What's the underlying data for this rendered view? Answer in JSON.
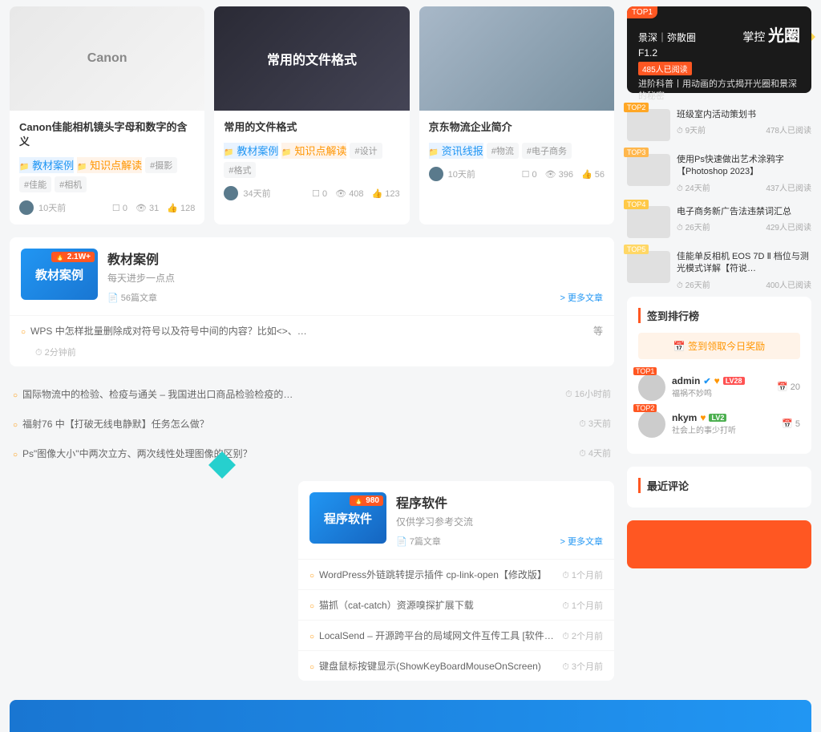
{
  "cards": [
    {
      "img_label": "Canon",
      "title": "Canon佳能相机镜头字母和数字的含义",
      "tags": [
        {
          "cls": "tag-cat blue",
          "icon": "📁",
          "label": "教材案例"
        },
        {
          "cls": "tag-cat",
          "icon": "📁",
          "label": "知识点解读"
        },
        {
          "cls": "tag",
          "label": "#摄影"
        },
        {
          "cls": "tag",
          "label": "#佳能"
        },
        {
          "cls": "tag",
          "label": "#相机"
        }
      ],
      "time": "10天前",
      "comments": "☐ 0",
      "views": "👁 31",
      "likes": "👍 128"
    },
    {
      "img_label": "常用的文件格式",
      "title": "常用的文件格式",
      "tags": [
        {
          "cls": "tag-cat blue",
          "icon": "📁",
          "label": "教材案例"
        },
        {
          "cls": "tag-cat",
          "icon": "📁",
          "label": "知识点解读"
        },
        {
          "cls": "tag",
          "label": "#设计"
        },
        {
          "cls": "tag",
          "label": "#格式"
        }
      ],
      "time": "34天前",
      "comments": "☐ 0",
      "views": "👁 408",
      "likes": "👍 123"
    },
    {
      "img_label": "",
      "title": "京东物流企业简介",
      "tags": [
        {
          "cls": "tag-cat blue",
          "icon": "📁",
          "label": "资讯线报"
        },
        {
          "cls": "tag",
          "label": "#物流"
        },
        {
          "cls": "tag",
          "label": "#电子商务"
        }
      ],
      "time": "10天前",
      "comments": "☐ 0",
      "views": "👁 396",
      "likes": "👍 56"
    }
  ],
  "panel1": {
    "thumb": "教材案例",
    "hot": "🔥 2.1W+",
    "title": "教材案例",
    "sub": "每天进步一点点",
    "count": "📄 56篇文章",
    "more": "> 更多文章",
    "items": [
      {
        "title": "WPS 中怎样批量删除成对符号以及符号中间的内容？比如<>、…",
        "extra": "等",
        "time": "⏱ 2分钟前"
      }
    ]
  },
  "simple_list": [
    {
      "title": "国际物流中的检验、检疫与通关 – 我国进出口商品检验检疫的…",
      "time": "⏱ 16小时前"
    },
    {
      "title": "福射76 中【打破无线电静默】任务怎么做？",
      "time": "⏱ 3天前"
    },
    {
      "title": "Ps\"图像大小\"中两次立方、两次线性处理图像的区别？",
      "time": "⏱ 4天前"
    }
  ],
  "panel2": {
    "thumb": "程序软件",
    "hot": "🔥 980",
    "title": "程序软件",
    "sub": "仅供学习参考交流",
    "count": "📄 7篇文章",
    "more": "> 更多文章",
    "items": [
      {
        "title": "WordPress外链跳转提示插件 cp-link-open【修改版】",
        "time": "⏱ 1个月前"
      },
      {
        "title": "猫抓（cat-catch）资源嗅探扩展下载",
        "time": "⏱ 1个月前"
      },
      {
        "title": "LocalSend – 开源跨平台的局域网文件互传工具 [软件…",
        "time": "⏱ 2个月前"
      },
      {
        "title": "键盘鼠标按键显示(ShowKeyBoardMouseOnScreen)",
        "time": "⏱ 3个月前"
      }
    ]
  },
  "hero": {
    "top": "TOP1",
    "line1": "景深｜弥散圈",
    "line1b": "掌控",
    "big": "光圈",
    "ver": "F1.2",
    "badge": "485人已阅读",
    "desc": "进阶科普丨用动画的方式揭开光圈和景深的秘密"
  },
  "ranks": [
    {
      "badge": "TOP2",
      "cls": "t2",
      "title": "班级室内活动策划书",
      "time": "⏱ 9天前",
      "reads": "478人已阅读"
    },
    {
      "badge": "TOP3",
      "cls": "t3",
      "title": "使用Ps快速做出艺术涂鸦字【Photoshop 2023】",
      "time": "⏱ 24天前",
      "reads": "437人已阅读"
    },
    {
      "badge": "TOP4",
      "cls": "t4",
      "title": "电子商务新广告法违禁词汇总",
      "time": "⏱ 26天前",
      "reads": "429人已阅读"
    },
    {
      "badge": "TOP5",
      "cls": "t5",
      "title": "佳能单反相机 EOS 7D Ⅱ 档位与测光模式详解【符说…",
      "time": "⏱ 26天前",
      "reads": "400人已阅读"
    }
  ],
  "signin": {
    "title": "签到排行榜",
    "btn": "📅 签到领取今日奖励"
  },
  "users": [
    {
      "badge": "TOP1",
      "name": "admin",
      "verify": "✔",
      "lv": "LV28",
      "lvcls": "lv-red",
      "sub": "福祸不妙鸣",
      "count": "📅 20"
    },
    {
      "badge": "TOP2",
      "name": "nkym",
      "lv": "LV2",
      "lvcls": "lv-green",
      "sub": "社会上的事少打听",
      "count": "📅 5"
    }
  ],
  "comments": {
    "title": "最近评论"
  }
}
